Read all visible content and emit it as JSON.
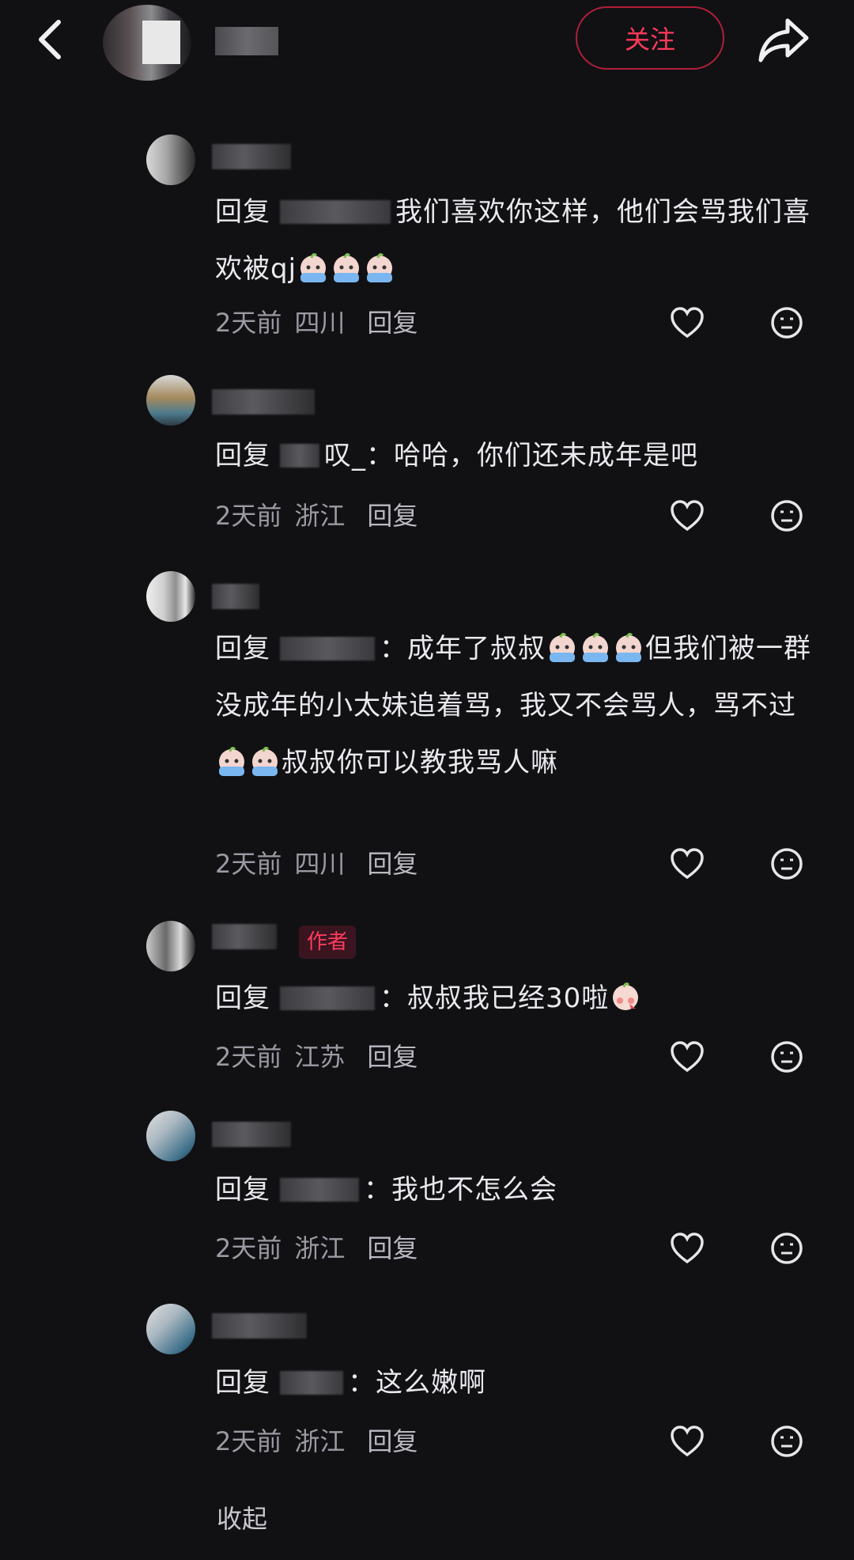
{
  "header": {
    "follow_label": "关注"
  },
  "comments": [
    {
      "reply_label": "回复",
      "text_before": "我们喜欢你这样，他们会骂我们喜欢被qj",
      "time": "2天前",
      "location": "四川",
      "reply_action": "回复"
    },
    {
      "reply_label": "回复",
      "mention_suffix": "叹_",
      "text_before": "：哈哈，你们还未成年是吧",
      "time": "2天前",
      "location": "浙江",
      "reply_action": "回复"
    },
    {
      "reply_label": "回复",
      "text_before": "：成年了叔叔",
      "text_mid": "但我们被一群没成年的小太妹追着骂，我又不会骂人，骂不过",
      "text_after": "叔叔你可以教我骂人嘛",
      "time": "2天前",
      "location": "四川",
      "reply_action": "回复"
    },
    {
      "badge": "作者",
      "reply_label": "回复",
      "text_before": "：叔叔我已经30啦",
      "time": "2天前",
      "location": "江苏",
      "reply_action": "回复"
    },
    {
      "reply_label": "回复",
      "text_before": "：我也不怎么会",
      "time": "2天前",
      "location": "浙江",
      "reply_action": "回复"
    },
    {
      "reply_label": "回复",
      "text_before": "：这么嫩啊",
      "time": "2天前",
      "location": "浙江",
      "reply_action": "回复"
    }
  ],
  "footer": {
    "collapse_label": "收起"
  },
  "icons": {
    "back": "chevron-left-icon",
    "share": "share-arrow-icon",
    "like": "heart-icon",
    "react": "emoji-face-icon",
    "inline_emoji": "crying-emoji",
    "shy_emoji": "shy-emoji"
  },
  "colors": {
    "background": "#111114",
    "accent": "#ff3a5a",
    "text": "#e9e9ee",
    "meta": "#9a9aa2"
  }
}
